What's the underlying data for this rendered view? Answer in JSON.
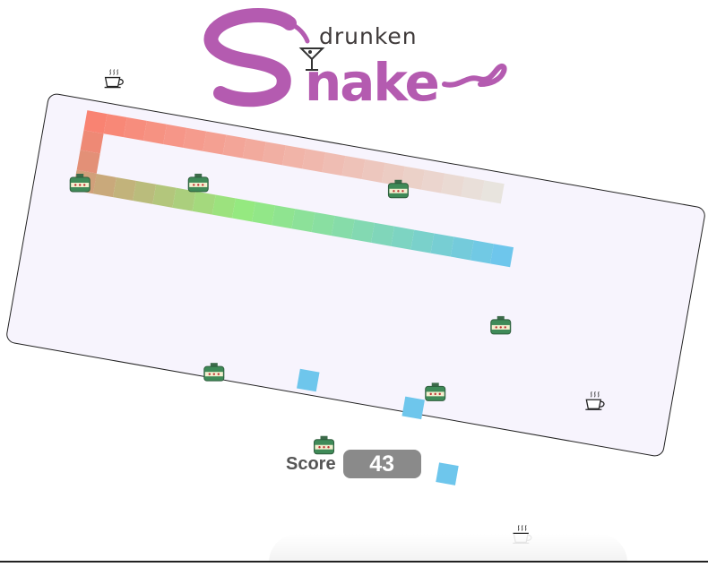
{
  "logo": {
    "word_top": "drunken",
    "word_main": "Snake",
    "color": "#b45bb0"
  },
  "board": {
    "background": "#f7f4fd",
    "border_color": "#222222",
    "rotation_deg": 10
  },
  "snake": {
    "colors": {
      "head": "#6ec6ec",
      "tail": "#e8e4de",
      "corner_top": "#f98372",
      "corner_bottom": "#d8967a",
      "green": "#96ea7e"
    }
  },
  "items": {
    "potion_icon": "bottle-icon",
    "coffee_icon": "coffee-cup-icon",
    "obstacle_color": "#6ec6ec"
  },
  "score": {
    "label": "Score",
    "value": "43"
  }
}
